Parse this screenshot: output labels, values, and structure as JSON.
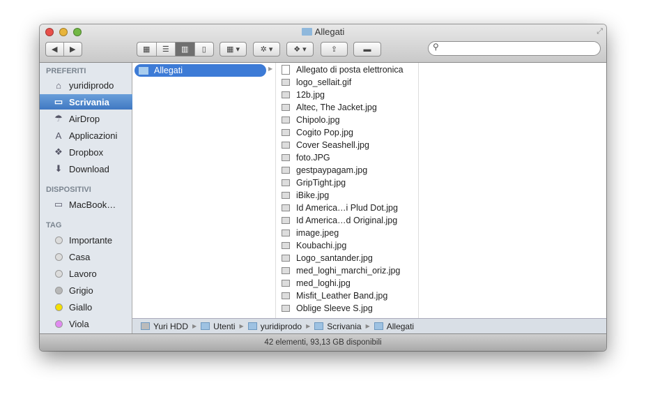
{
  "window": {
    "title": "Allegati"
  },
  "toolbar": {
    "search_placeholder": ""
  },
  "sidebar": {
    "sections": [
      {
        "title": "PREFERITI",
        "items": [
          {
            "label": "yuridiprodo",
            "icon": "home-icon"
          },
          {
            "label": "Scrivania",
            "icon": "desktop-icon",
            "selected": true
          },
          {
            "label": "AirDrop",
            "icon": "airdrop-icon"
          },
          {
            "label": "Applicazioni",
            "icon": "applications-icon"
          },
          {
            "label": "Dropbox",
            "icon": "dropbox-icon"
          },
          {
            "label": "Download",
            "icon": "download-icon"
          }
        ]
      },
      {
        "title": "DISPOSITIVI",
        "items": [
          {
            "label": "MacBook…",
            "icon": "laptop-icon"
          }
        ]
      },
      {
        "title": "TAG",
        "items": [
          {
            "label": "Importante",
            "color": "#dcdcdc"
          },
          {
            "label": "Casa",
            "color": "#dcdcdc"
          },
          {
            "label": "Lavoro",
            "color": "#dcdcdc"
          },
          {
            "label": "Grigio",
            "color": "#b8b8b8"
          },
          {
            "label": "Giallo",
            "color": "#f5e000"
          },
          {
            "label": "Viola",
            "color": "#e08af0"
          }
        ]
      }
    ]
  },
  "column1": {
    "selected": "Allegati"
  },
  "column2": {
    "files": [
      "Allegato di posta elettronica",
      "logo_sellait.gif",
      "12b.jpg",
      "Altec, The Jacket.jpg",
      "Chipolo.jpg",
      "Cogito Pop.jpg",
      "Cover Seashell.jpg",
      "foto.JPG",
      "gestpaypagam.jpg",
      "GripTight.jpg",
      "iBike.jpg",
      "Id America…i Plud Dot.jpg",
      "Id America…d Original.jpg",
      "image.jpeg",
      "Koubachi.jpg",
      "Logo_santander.jpg",
      "med_loghi_marchi_oriz.jpg",
      "med_loghi.jpg",
      "Misfit_Leather Band.jpg",
      "Oblige Sleeve S.jpg"
    ]
  },
  "pathbar": [
    "Yuri HDD",
    "Utenti",
    "yuridiprodo",
    "Scrivania",
    "Allegati"
  ],
  "status": "42 elementi, 93,13 GB disponibili"
}
